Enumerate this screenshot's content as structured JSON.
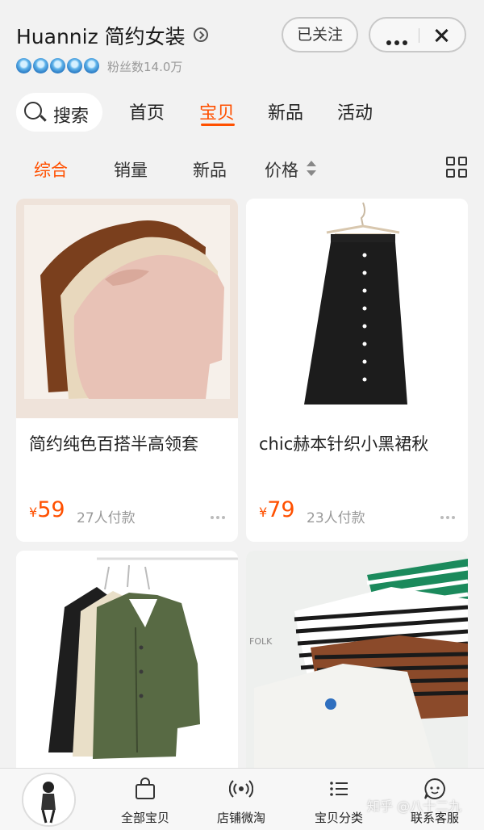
{
  "header": {
    "shop_name": "Huanniz 简约女装",
    "follow_label": "已关注",
    "fans_text": "粉丝数14.0万",
    "crown_count": 5
  },
  "nav": {
    "search_label": "搜索",
    "tabs": [
      {
        "label": "首页",
        "active": false
      },
      {
        "label": "宝贝",
        "active": true
      },
      {
        "label": "新品",
        "active": false
      },
      {
        "label": "活动",
        "active": false
      }
    ]
  },
  "sort": {
    "items": [
      {
        "label": "综合",
        "active": true
      },
      {
        "label": "销量",
        "active": false
      },
      {
        "label": "新品",
        "active": false
      },
      {
        "label": "价格",
        "active": false
      }
    ]
  },
  "products": [
    {
      "title": "简约纯色百搭半高领套",
      "currency": "¥",
      "price": "59",
      "sold": "27人付款"
    },
    {
      "title": "chic赫本针织小黑裙秋",
      "currency": "¥",
      "price": "79",
      "sold": "23人付款"
    },
    {
      "title": "",
      "currency": "",
      "price": "",
      "sold": ""
    },
    {
      "title": "",
      "currency": "",
      "price": "",
      "sold": ""
    }
  ],
  "bottom_bar": {
    "items": [
      {
        "label": "全部宝贝",
        "icon": "shopping-bag-icon"
      },
      {
        "label": "店铺微淘",
        "icon": "broadcast-icon"
      },
      {
        "label": "宝贝分类",
        "icon": "list-icon"
      },
      {
        "label": "联系客服",
        "icon": "chat-face-icon"
      }
    ]
  },
  "watermark": "知乎 @八十二九",
  "colors": {
    "accent": "#ff5000",
    "background": "#f2f2f2"
  }
}
